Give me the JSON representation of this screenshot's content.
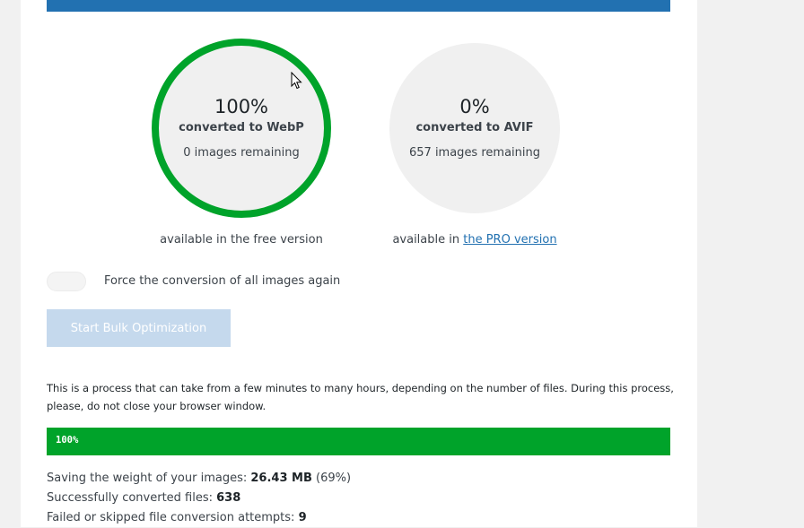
{
  "colors": {
    "primary": "#2271b1",
    "success": "#00a32a",
    "button_disabled": "#c5d9ed",
    "circle_bg": "#f0f0f0"
  },
  "webp": {
    "percent": "100%",
    "label": "converted to WebP",
    "remaining": "0 images remaining",
    "caption": "available in the free version",
    "progress_fraction": 1.0
  },
  "avif": {
    "percent": "0%",
    "label": "converted to AVIF",
    "remaining": "657 images remaining",
    "caption_prefix": "available in ",
    "caption_link": "the PRO version",
    "progress_fraction": 0.0
  },
  "force_toggle": {
    "label": "Force the conversion of all images again",
    "checked": false
  },
  "start_button": {
    "label": "Start Bulk Optimization",
    "disabled": true
  },
  "notice": "This is a process that can take from a few minutes to many hours, depending on the number of files. During this process, please, do not close your browser window.",
  "progress": {
    "text": "100%",
    "value": 100
  },
  "stats": {
    "saving_label": "Saving the weight of your images: ",
    "saving_value": "26.43 MB",
    "saving_percent": " (69%)",
    "converted_label": "Successfully converted files: ",
    "converted_value": "638",
    "failed_label": "Failed or skipped file conversion attempts: ",
    "failed_value": "9"
  },
  "cursor_icon": "arrow-cursor"
}
